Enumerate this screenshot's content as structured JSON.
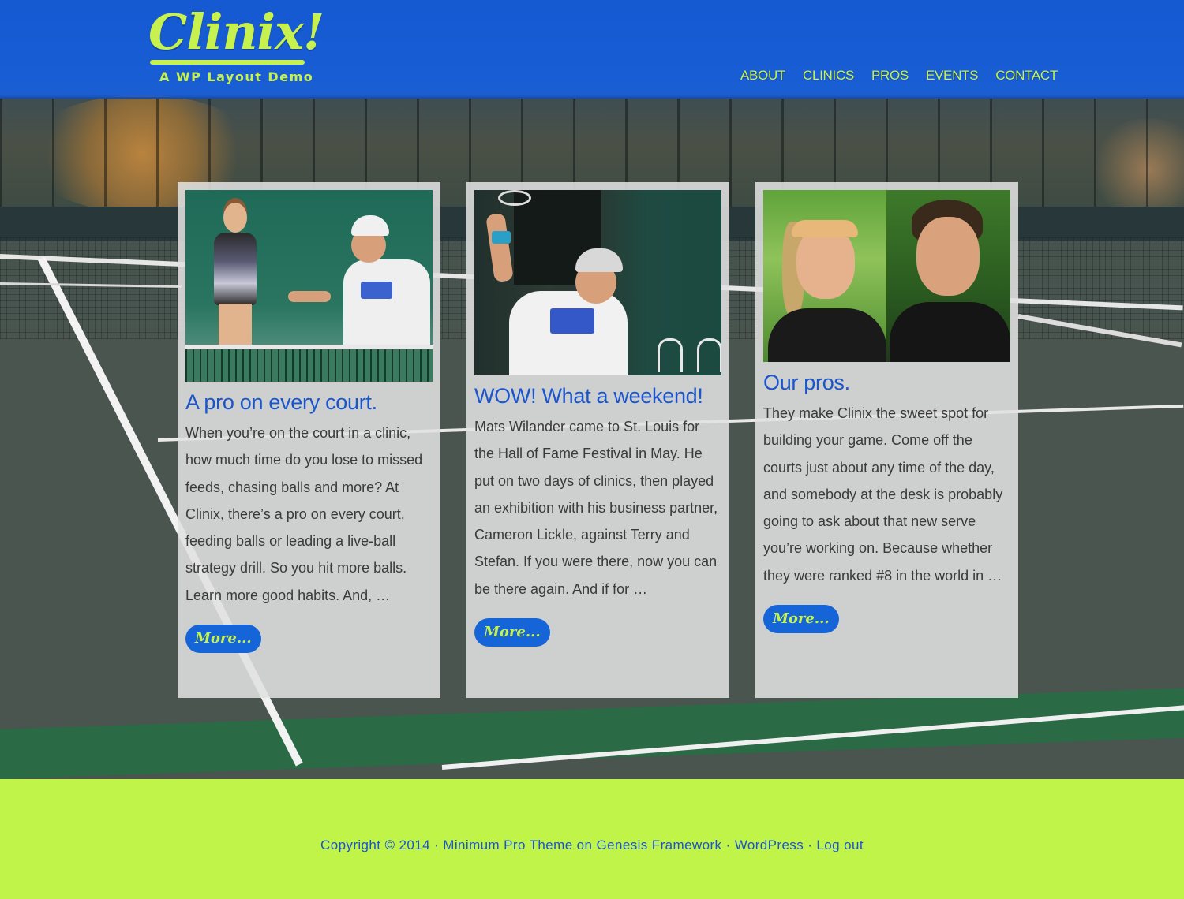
{
  "header": {
    "logo_title": "Clinix!",
    "logo_subtitle": "A WP Layout Demo",
    "nav": [
      "ABOUT",
      "CLINICS",
      "PROS",
      "EVENTS",
      "CONTACT"
    ]
  },
  "cards": [
    {
      "title": "A pro on every court.",
      "body": "When you’re on the court in a clinic, how much time do you lose to missed feeds, chasing balls and more? At Clinix, there’s a pro on every court, feeding balls or leading a live-ball strategy drill. So you hit more balls. Learn more good habits. And, …",
      "more": "More..."
    },
    {
      "title": "WOW! What a weekend!",
      "body": "Mats Wilander came to St. Louis for the Hall of Fame Festival in May. He put on two days of clinics, then played an exhibition with his business partner, Cameron Lickle, against Terry and Stefan. If you were there, now you can be there again. And if for …",
      "more": "More..."
    },
    {
      "title": "Our pros.",
      "body": "They make Clinix the sweet spot for building your game. Come off the courts just about any time of the day, and somebody at the desk is probably going to ask about that new serve you’re working on. Because whether they were ranked #8 in the world in …",
      "more": "More..."
    }
  ],
  "footer": {
    "copyright": "Copyright © 2014 ·",
    "theme_link": "Minimum Pro Theme",
    "on": "on",
    "framework_link": "Genesis Framework",
    "sep1": "·",
    "wordpress_link": "WordPress",
    "sep2": "·",
    "logout_link": "Log out"
  },
  "colors": {
    "header_blue": "#1565d8",
    "accent_lime": "#c6f14f",
    "footer_lime": "#c0f449",
    "link_blue": "#1a55cc"
  },
  "icons": [
    "photo-coach-clinic",
    "photo-player-serve",
    "photo-two-pros"
  ]
}
